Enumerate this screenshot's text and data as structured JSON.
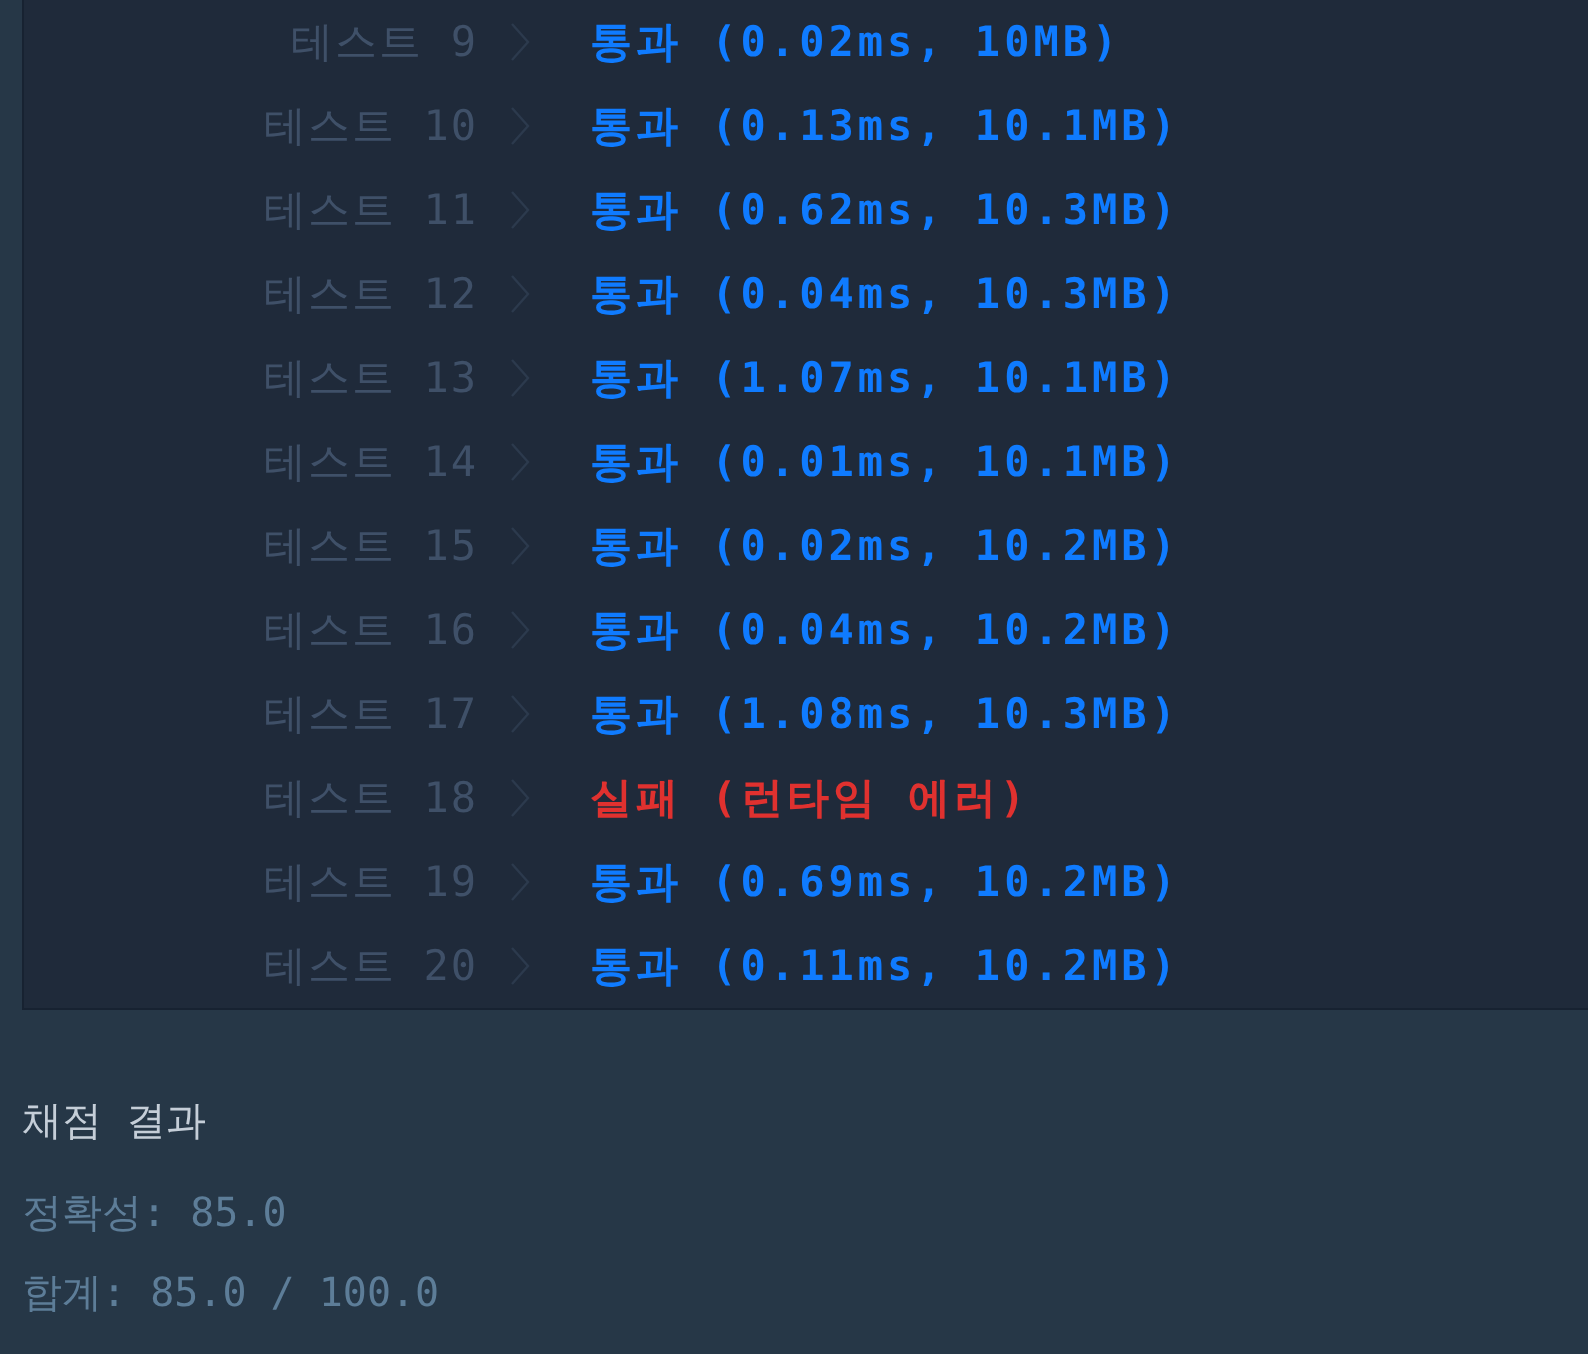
{
  "tests": [
    {
      "label": "테스트 9",
      "result": "통과 (0.02ms, 10MB)",
      "passed": true
    },
    {
      "label": "테스트 10",
      "result": "통과 (0.13ms, 10.1MB)",
      "passed": true
    },
    {
      "label": "테스트 11",
      "result": "통과 (0.62ms, 10.3MB)",
      "passed": true
    },
    {
      "label": "테스트 12",
      "result": "통과 (0.04ms, 10.3MB)",
      "passed": true
    },
    {
      "label": "테스트 13",
      "result": "통과 (1.07ms, 10.1MB)",
      "passed": true
    },
    {
      "label": "테스트 14",
      "result": "통과 (0.01ms, 10.1MB)",
      "passed": true
    },
    {
      "label": "테스트 15",
      "result": "통과 (0.02ms, 10.2MB)",
      "passed": true
    },
    {
      "label": "테스트 16",
      "result": "통과 (0.04ms, 10.2MB)",
      "passed": true
    },
    {
      "label": "테스트 17",
      "result": "통과 (1.08ms, 10.3MB)",
      "passed": true
    },
    {
      "label": "테스트 18",
      "result": "실패 (런타임 에러)",
      "passed": false
    },
    {
      "label": "테스트 19",
      "result": "통과 (0.69ms, 10.2MB)",
      "passed": true
    },
    {
      "label": "테스트 20",
      "result": "통과 (0.11ms, 10.2MB)",
      "passed": true
    }
  ],
  "summary": {
    "title": "채점 결과",
    "accuracy": "정확성: 85.0",
    "total": "합계: 85.0 / 100.0"
  }
}
